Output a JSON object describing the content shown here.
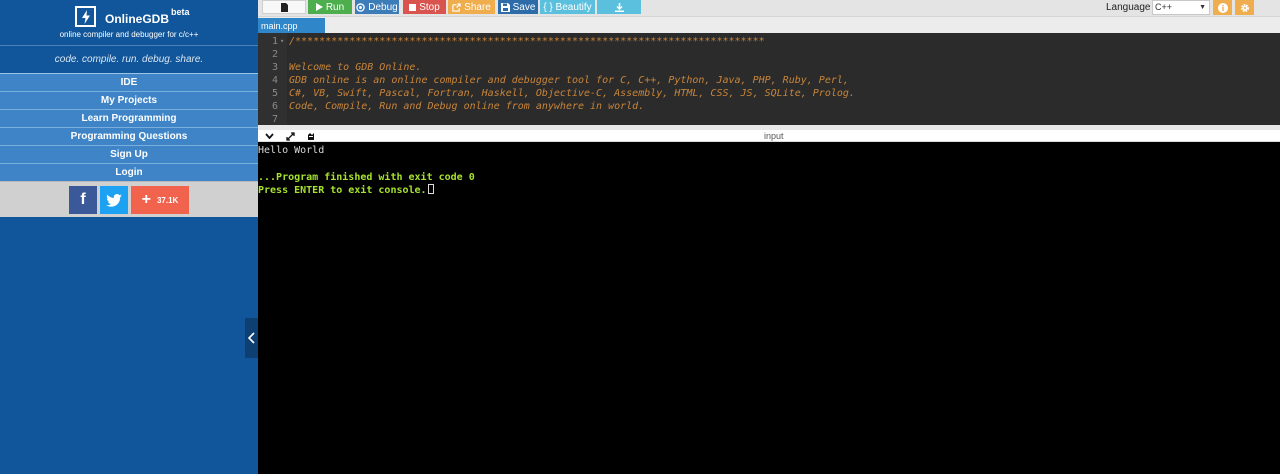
{
  "brand": {
    "name": "OnlineGDB",
    "badge": "beta",
    "tagline": "online compiler and debugger for c/c++",
    "motto": "code. compile. run. debug. share."
  },
  "nav": [
    {
      "label": "IDE"
    },
    {
      "label": "My Projects"
    },
    {
      "label": "Learn Programming"
    },
    {
      "label": "Programming Questions"
    },
    {
      "label": "Sign Up"
    },
    {
      "label": "Login"
    }
  ],
  "social": {
    "facebook_icon": "facebook-icon",
    "twitter_icon": "twitter-icon",
    "share_count": "37.1K"
  },
  "toolbar": {
    "run": "Run",
    "debug": "Debug",
    "stop": "Stop",
    "share": "Share",
    "save": "Save",
    "beautify": "{ } Beautify",
    "language_label": "Language",
    "language_value": "C++"
  },
  "tabs": [
    {
      "label": "main.cpp"
    }
  ],
  "editor": {
    "lines": [
      {
        "n": "1",
        "text": "/******************************************************************************"
      },
      {
        "n": "2",
        "text": ""
      },
      {
        "n": "3",
        "text": "Welcome to GDB Online."
      },
      {
        "n": "4",
        "text": "GDB online is an online compiler and debugger tool for C, C++, Python, Java, PHP, Ruby, Perl,"
      },
      {
        "n": "5",
        "text": "C#, VB, Swift, Pascal, Fortran, Haskell, Objective-C, Assembly, HTML, CSS, JS, SQLite, Prolog."
      },
      {
        "n": "6",
        "text": "Code, Compile, Run and Debug online from anywhere in world."
      },
      {
        "n": "7",
        "text": ""
      }
    ]
  },
  "console": {
    "input_label": "input",
    "output": [
      {
        "text": "Hello World",
        "style": "white"
      },
      {
        "text": "",
        "style": "white"
      },
      {
        "text": "...Program finished with exit code 0",
        "style": "green"
      },
      {
        "text": "Press ENTER to exit console.",
        "style": "green"
      }
    ]
  },
  "colors": {
    "sidebar": "#11569a",
    "nav_item": "#3e84c6",
    "run": "#4cae4c",
    "stop": "#d9534f",
    "share": "#f0ad4e",
    "console_green": "#a6e22e",
    "code_comment": "#c9853a"
  }
}
